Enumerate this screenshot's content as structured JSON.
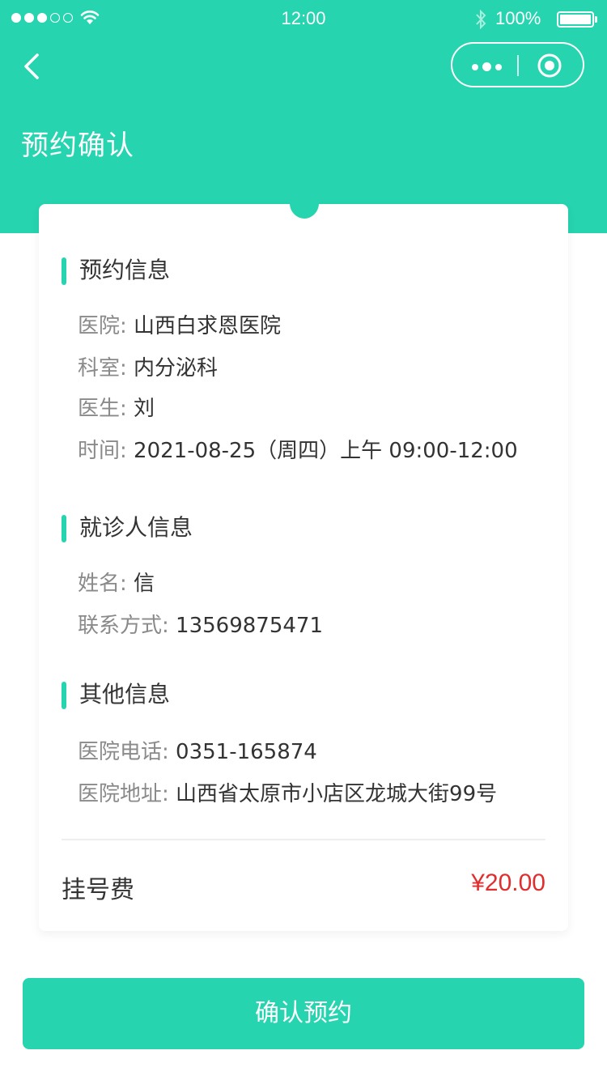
{
  "status_bar": {
    "time": "12:00",
    "battery": "100%"
  },
  "nav": {
    "title": "预约确认",
    "back_icon": "chevron-left-icon",
    "menu_icon": "more-dots-icon",
    "close_icon": "target-icon"
  },
  "colors": {
    "brand": "#26d4b0",
    "fee": "#e02e2e"
  },
  "appointment": {
    "title": "预约信息",
    "hospital_label": "医院:",
    "hospital": "山西白求恩医院",
    "department_label": "科室:",
    "department": "内分泌科",
    "doctor_label": "医生:",
    "doctor": "刘",
    "time_label": "时间:",
    "time": "2021-08-25（周四）上午  09:00-12:00"
  },
  "patient": {
    "title": "就诊人信息",
    "name_label": "姓名:",
    "name": "信",
    "contact_label": "联系方式:",
    "contact": "13569875471"
  },
  "other": {
    "title": "其他信息",
    "phone_label": "医院电话:",
    "phone": "0351-165874",
    "address_label": "医院地址:",
    "address": "山西省太原市小店区龙城大街99号"
  },
  "fee": {
    "label": "挂号费",
    "value": "¥20.00"
  },
  "confirm_button": "确认预约"
}
